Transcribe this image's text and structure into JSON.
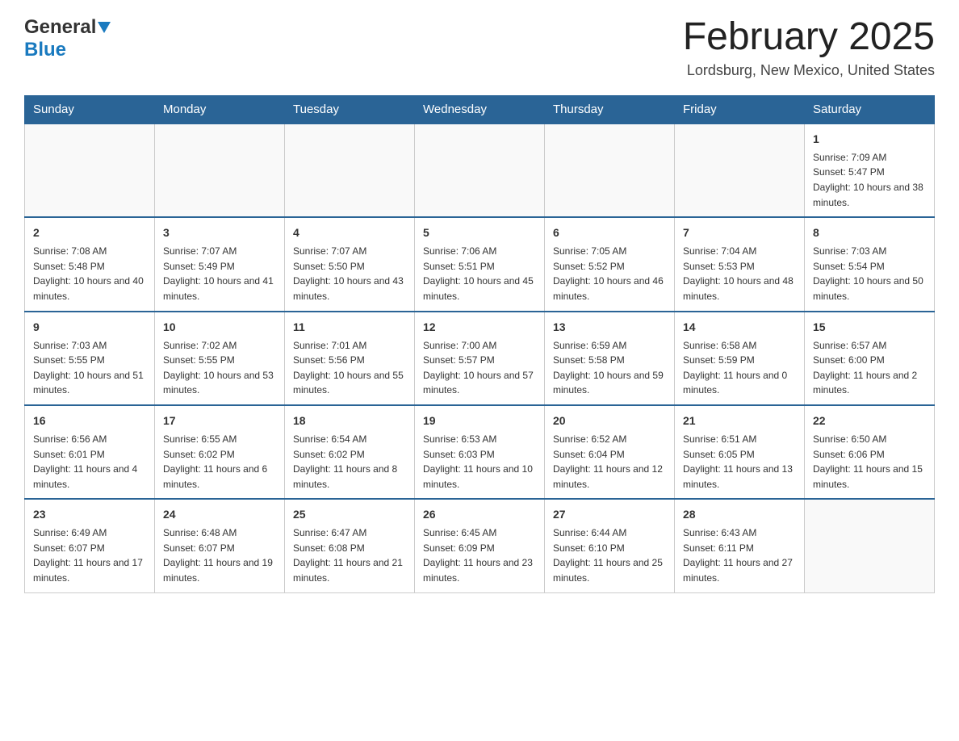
{
  "header": {
    "logo_general": "General",
    "logo_blue": "Blue",
    "month_title": "February 2025",
    "location": "Lordsburg, New Mexico, United States"
  },
  "days_of_week": [
    "Sunday",
    "Monday",
    "Tuesday",
    "Wednesday",
    "Thursday",
    "Friday",
    "Saturday"
  ],
  "weeks": [
    {
      "days": [
        {
          "number": "",
          "sunrise": "",
          "sunset": "",
          "daylight": "",
          "empty": true
        },
        {
          "number": "",
          "sunrise": "",
          "sunset": "",
          "daylight": "",
          "empty": true
        },
        {
          "number": "",
          "sunrise": "",
          "sunset": "",
          "daylight": "",
          "empty": true
        },
        {
          "number": "",
          "sunrise": "",
          "sunset": "",
          "daylight": "",
          "empty": true
        },
        {
          "number": "",
          "sunrise": "",
          "sunset": "",
          "daylight": "",
          "empty": true
        },
        {
          "number": "",
          "sunrise": "",
          "sunset": "",
          "daylight": "",
          "empty": true
        },
        {
          "number": "1",
          "sunrise": "Sunrise: 7:09 AM",
          "sunset": "Sunset: 5:47 PM",
          "daylight": "Daylight: 10 hours and 38 minutes.",
          "empty": false
        }
      ]
    },
    {
      "days": [
        {
          "number": "2",
          "sunrise": "Sunrise: 7:08 AM",
          "sunset": "Sunset: 5:48 PM",
          "daylight": "Daylight: 10 hours and 40 minutes.",
          "empty": false
        },
        {
          "number": "3",
          "sunrise": "Sunrise: 7:07 AM",
          "sunset": "Sunset: 5:49 PM",
          "daylight": "Daylight: 10 hours and 41 minutes.",
          "empty": false
        },
        {
          "number": "4",
          "sunrise": "Sunrise: 7:07 AM",
          "sunset": "Sunset: 5:50 PM",
          "daylight": "Daylight: 10 hours and 43 minutes.",
          "empty": false
        },
        {
          "number": "5",
          "sunrise": "Sunrise: 7:06 AM",
          "sunset": "Sunset: 5:51 PM",
          "daylight": "Daylight: 10 hours and 45 minutes.",
          "empty": false
        },
        {
          "number": "6",
          "sunrise": "Sunrise: 7:05 AM",
          "sunset": "Sunset: 5:52 PM",
          "daylight": "Daylight: 10 hours and 46 minutes.",
          "empty": false
        },
        {
          "number": "7",
          "sunrise": "Sunrise: 7:04 AM",
          "sunset": "Sunset: 5:53 PM",
          "daylight": "Daylight: 10 hours and 48 minutes.",
          "empty": false
        },
        {
          "number": "8",
          "sunrise": "Sunrise: 7:03 AM",
          "sunset": "Sunset: 5:54 PM",
          "daylight": "Daylight: 10 hours and 50 minutes.",
          "empty": false
        }
      ]
    },
    {
      "days": [
        {
          "number": "9",
          "sunrise": "Sunrise: 7:03 AM",
          "sunset": "Sunset: 5:55 PM",
          "daylight": "Daylight: 10 hours and 51 minutes.",
          "empty": false
        },
        {
          "number": "10",
          "sunrise": "Sunrise: 7:02 AM",
          "sunset": "Sunset: 5:55 PM",
          "daylight": "Daylight: 10 hours and 53 minutes.",
          "empty": false
        },
        {
          "number": "11",
          "sunrise": "Sunrise: 7:01 AM",
          "sunset": "Sunset: 5:56 PM",
          "daylight": "Daylight: 10 hours and 55 minutes.",
          "empty": false
        },
        {
          "number": "12",
          "sunrise": "Sunrise: 7:00 AM",
          "sunset": "Sunset: 5:57 PM",
          "daylight": "Daylight: 10 hours and 57 minutes.",
          "empty": false
        },
        {
          "number": "13",
          "sunrise": "Sunrise: 6:59 AM",
          "sunset": "Sunset: 5:58 PM",
          "daylight": "Daylight: 10 hours and 59 minutes.",
          "empty": false
        },
        {
          "number": "14",
          "sunrise": "Sunrise: 6:58 AM",
          "sunset": "Sunset: 5:59 PM",
          "daylight": "Daylight: 11 hours and 0 minutes.",
          "empty": false
        },
        {
          "number": "15",
          "sunrise": "Sunrise: 6:57 AM",
          "sunset": "Sunset: 6:00 PM",
          "daylight": "Daylight: 11 hours and 2 minutes.",
          "empty": false
        }
      ]
    },
    {
      "days": [
        {
          "number": "16",
          "sunrise": "Sunrise: 6:56 AM",
          "sunset": "Sunset: 6:01 PM",
          "daylight": "Daylight: 11 hours and 4 minutes.",
          "empty": false
        },
        {
          "number": "17",
          "sunrise": "Sunrise: 6:55 AM",
          "sunset": "Sunset: 6:02 PM",
          "daylight": "Daylight: 11 hours and 6 minutes.",
          "empty": false
        },
        {
          "number": "18",
          "sunrise": "Sunrise: 6:54 AM",
          "sunset": "Sunset: 6:02 PM",
          "daylight": "Daylight: 11 hours and 8 minutes.",
          "empty": false
        },
        {
          "number": "19",
          "sunrise": "Sunrise: 6:53 AM",
          "sunset": "Sunset: 6:03 PM",
          "daylight": "Daylight: 11 hours and 10 minutes.",
          "empty": false
        },
        {
          "number": "20",
          "sunrise": "Sunrise: 6:52 AM",
          "sunset": "Sunset: 6:04 PM",
          "daylight": "Daylight: 11 hours and 12 minutes.",
          "empty": false
        },
        {
          "number": "21",
          "sunrise": "Sunrise: 6:51 AM",
          "sunset": "Sunset: 6:05 PM",
          "daylight": "Daylight: 11 hours and 13 minutes.",
          "empty": false
        },
        {
          "number": "22",
          "sunrise": "Sunrise: 6:50 AM",
          "sunset": "Sunset: 6:06 PM",
          "daylight": "Daylight: 11 hours and 15 minutes.",
          "empty": false
        }
      ]
    },
    {
      "days": [
        {
          "number": "23",
          "sunrise": "Sunrise: 6:49 AM",
          "sunset": "Sunset: 6:07 PM",
          "daylight": "Daylight: 11 hours and 17 minutes.",
          "empty": false
        },
        {
          "number": "24",
          "sunrise": "Sunrise: 6:48 AM",
          "sunset": "Sunset: 6:07 PM",
          "daylight": "Daylight: 11 hours and 19 minutes.",
          "empty": false
        },
        {
          "number": "25",
          "sunrise": "Sunrise: 6:47 AM",
          "sunset": "Sunset: 6:08 PM",
          "daylight": "Daylight: 11 hours and 21 minutes.",
          "empty": false
        },
        {
          "number": "26",
          "sunrise": "Sunrise: 6:45 AM",
          "sunset": "Sunset: 6:09 PM",
          "daylight": "Daylight: 11 hours and 23 minutes.",
          "empty": false
        },
        {
          "number": "27",
          "sunrise": "Sunrise: 6:44 AM",
          "sunset": "Sunset: 6:10 PM",
          "daylight": "Daylight: 11 hours and 25 minutes.",
          "empty": false
        },
        {
          "number": "28",
          "sunrise": "Sunrise: 6:43 AM",
          "sunset": "Sunset: 6:11 PM",
          "daylight": "Daylight: 11 hours and 27 minutes.",
          "empty": false
        },
        {
          "number": "",
          "sunrise": "",
          "sunset": "",
          "daylight": "",
          "empty": true
        }
      ]
    }
  ]
}
